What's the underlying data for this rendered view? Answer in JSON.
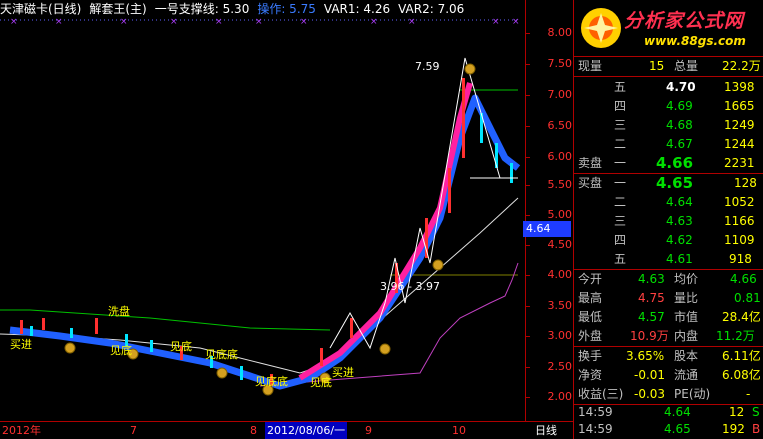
{
  "header": {
    "title": "天津磁卡(日线)",
    "indicator": "解套王(主)",
    "support_label": "一号支撑线: 5.30",
    "op_label": "操作: 5.75",
    "var1": "VAR1: 4.26",
    "var2": "VAR2: 7.06"
  },
  "price_axis": [
    "8.00",
    "7.50",
    "7.00",
    "6.50",
    "6.00",
    "5.50",
    "5.00",
    "4.50",
    "4.00",
    "3.50",
    "3.00",
    "2.50",
    "2.00"
  ],
  "current_price": "4.64",
  "annotations": {
    "peak": "7.59",
    "range": "3.96 - 3.97",
    "wash": "洗盘",
    "buy": "买进",
    "bottom": "见底",
    "bottom2": "见底底"
  },
  "date_axis": {
    "y2012": "2012年",
    "m7": "7",
    "m8": "8",
    "active_date": "2012/08/06/一",
    "m9": "9",
    "m10": "10",
    "period": "日线"
  },
  "logo": {
    "title": "分析家公式网",
    "url": "www.88gs.com"
  },
  "quote": {
    "current_vol_label": "现量",
    "current_vol": "15",
    "total_vol_label": "总量",
    "total_vol": "22.2万",
    "asks": [
      {
        "lv": "五",
        "price": "4.70",
        "vol": "1398"
      },
      {
        "lv": "四",
        "price": "4.69",
        "vol": "1665"
      },
      {
        "lv": "三",
        "price": "4.68",
        "vol": "1249"
      },
      {
        "lv": "二",
        "price": "4.67",
        "vol": "1244"
      },
      {
        "lv": "一",
        "price": "4.66",
        "vol": "2231"
      }
    ],
    "sell_label": "卖盘",
    "buy_label": "买盘",
    "bids": [
      {
        "lv": "一",
        "price": "4.65",
        "vol": "128"
      },
      {
        "lv": "二",
        "price": "4.64",
        "vol": "1052"
      },
      {
        "lv": "三",
        "price": "4.63",
        "vol": "1166"
      },
      {
        "lv": "四",
        "price": "4.62",
        "vol": "1109"
      },
      {
        "lv": "五",
        "price": "4.61",
        "vol": "918"
      }
    ],
    "stats": [
      {
        "l1": "今开",
        "v1": "4.63",
        "l2": "均价",
        "v2": "4.66"
      },
      {
        "l1": "最高",
        "v1": "4.75",
        "l2": "量比",
        "v2": "0.81"
      },
      {
        "l1": "最低",
        "v1": "4.57",
        "l2": "市值",
        "v2": "28.4亿"
      },
      {
        "l1": "外盘",
        "v1": "10.9万",
        "l2": "内盘",
        "v2": "11.2万"
      }
    ],
    "stats2": [
      {
        "l1": "换手",
        "v1": "3.65%",
        "l2": "股本",
        "v2": "6.11亿"
      },
      {
        "l1": "净资",
        "v1": "-0.01",
        "l2": "流通",
        "v2": "6.08亿"
      },
      {
        "l1": "收益(三)",
        "v1": "-0.03",
        "l2": "PE(动)",
        "v2": "-"
      }
    ],
    "ticks": [
      {
        "time": "14:59",
        "price": "4.64",
        "vol": "12",
        "flag": "S"
      },
      {
        "time": "14:59",
        "price": "4.65",
        "vol": "192",
        "flag": "B"
      }
    ]
  },
  "colors": {
    "up": "#ff3030",
    "down": "#00e5ff",
    "bg": "#000000",
    "grid": "#b00000"
  }
}
